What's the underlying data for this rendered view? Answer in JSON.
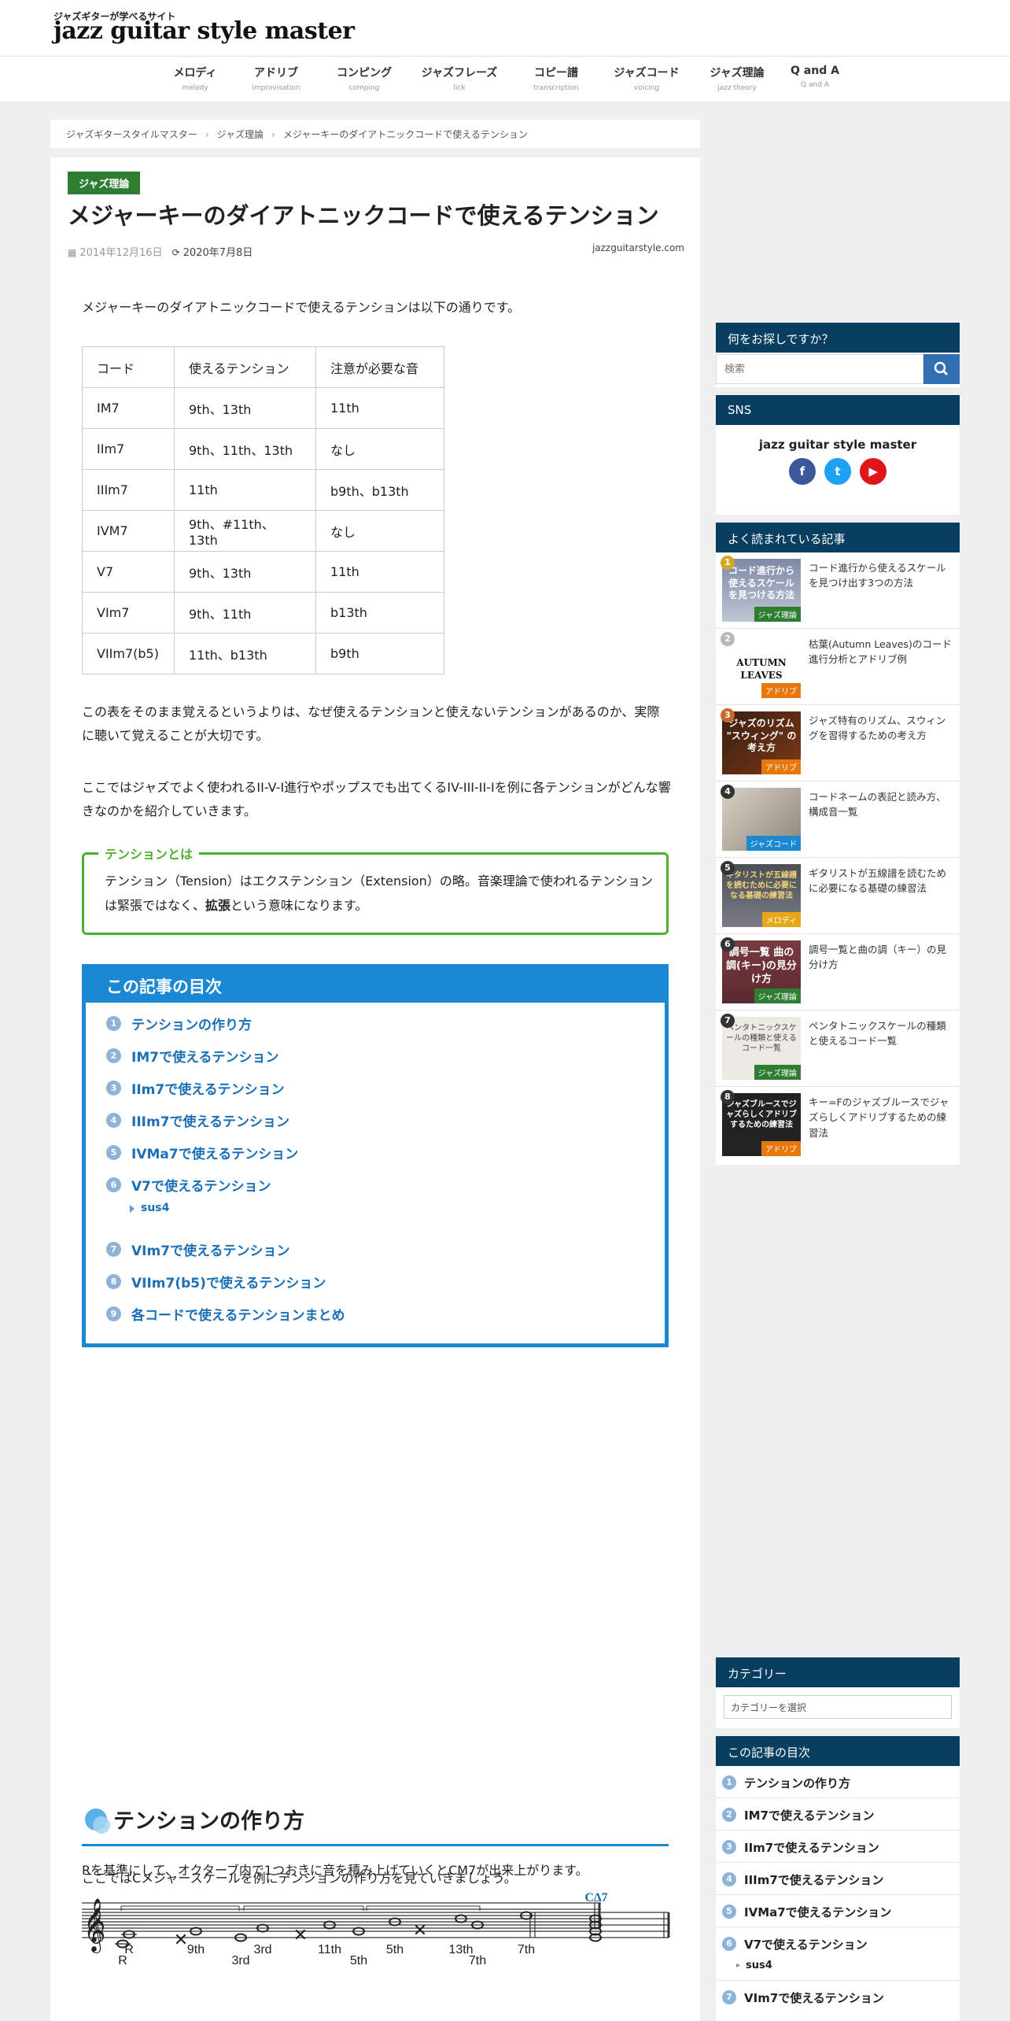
{
  "header": {
    "tagline": "ジャズギターが学べるサイト",
    "logo": "jazz guitar style master"
  },
  "nav": [
    {
      "label": "メロディ",
      "sub": "melody"
    },
    {
      "label": "アドリブ",
      "sub": "improvisation"
    },
    {
      "label": "コンピング",
      "sub": "comping"
    },
    {
      "label": "ジャズフレーズ",
      "sub": "lick"
    },
    {
      "label": "コピー譜",
      "sub": "transcription"
    },
    {
      "label": "ジャズコード",
      "sub": "voicing"
    },
    {
      "label": "ジャズ理論",
      "sub": "jazz theory"
    },
    {
      "label": "Q and A",
      "sub": "Q and A"
    }
  ],
  "breadcrumb": [
    "ジャズギタースタイルマスター",
    "ジャズ理論",
    "メジャーキーのダイアトニックコードで使えるテンション"
  ],
  "article": {
    "category": "ジャズ理論",
    "title": "メジャーキーのダイアトニックコードで使えるテンション",
    "published": "2014年12月16日",
    "modified": "2020年7月8日",
    "domain": "jazzguitarstyle.com",
    "intro": "メジャーキーのダイアトニックコードで使えるテンションは以下の通りです。",
    "table": {
      "headers": [
        "コード",
        "使えるテンション",
        "注意が必要な音"
      ],
      "rows": [
        [
          "IM7",
          "9th、13th",
          "11th"
        ],
        [
          "IIm7",
          "9th、11th、13th",
          "なし"
        ],
        [
          "IIIm7",
          "11th",
          "b9th、b13th"
        ],
        [
          "IVM7",
          "9th、#11th、13th",
          "なし"
        ],
        [
          "V7",
          "9th、13th",
          "11th"
        ],
        [
          "VIm7",
          "9th、11th",
          "b13th"
        ],
        [
          "VIIm7(b5)",
          "11th、b13th",
          "b9th"
        ]
      ]
    },
    "para1": "この表をそのまま覚えるというよりは、なぜ使えるテンションと使えないテンションがあるのか、実際に聴いて覚えることが大切です。",
    "para2": "ここではジャズでよく使われるII-V-I進行やポップスでも出てくるIV-III-II-Iを例に各テンションがどんな響きなのかを紹介していきます。",
    "box": {
      "title": "テンションとは",
      "text_before": "テンション（Tension）はエクステンション（Extension）の略。音楽理論で使われるテンションは緊張ではなく、",
      "text_bold": "拡張",
      "text_after": "という意味になります。"
    },
    "toc": {
      "title": "この記事の目次",
      "items": [
        "テンションの作り方",
        "IM7で使えるテンション",
        "IIm7で使えるテンション",
        "IIIm7で使えるテンション",
        "IVMa7で使えるテンション",
        "V7で使えるテンション",
        "VIm7で使えるテンション",
        "VIIm7(b5)で使えるテンション",
        "各コードで使えるテンションまとめ"
      ],
      "sub_item": "sus4"
    },
    "h2": "テンションの作り方",
    "para3": "ここではCメジャースケールを例にテンションの作り方を見ていきましょう。",
    "score1_labels": [
      "R",
      "9th",
      "3rd",
      "11th",
      "5th",
      "13th",
      "7th"
    ],
    "para4": "Rを基準にして、オクターブ内で1つおきに音を積み上げていくとCM7が出来上がります。",
    "score2_labels": [
      "R",
      "3rd",
      "5th",
      "7th"
    ],
    "score2_chord": "C∆7"
  },
  "sidebar": {
    "search": {
      "title": "何をお探しですか？",
      "placeholder": "検索"
    },
    "sns": {
      "title": "SNS",
      "name": "jazz guitar style master",
      "icons": [
        "facebook-icon",
        "twitter-icon",
        "youtube-icon"
      ]
    },
    "popular": {
      "title": "よく読まれている記事",
      "items": [
        {
          "rank": "1",
          "title": "コード進行から使えるスケールを見つけ出す3つの方法",
          "tag": "ジャズ理論",
          "thumb_text": "コード進行から使えるスケールを見つける方法"
        },
        {
          "rank": "2",
          "title": "枯葉(Autumn Leaves)のコード進行分析とアドリブ例",
          "tag": "アドリブ",
          "thumb_text": "AUTUMN LEAVES"
        },
        {
          "rank": "3",
          "title": "ジャズ特有のリズム、スウィングを習得するための考え方",
          "tag": "アドリブ",
          "thumb_text": "ジャズのリズム \"スウィング\" の考え方"
        },
        {
          "rank": "4",
          "title": "コードネームの表記と読み方、構成音一覧",
          "tag": "ジャズコード",
          "thumb_text": ""
        },
        {
          "rank": "5",
          "title": "ギタリストが五線譜を読むために必要になる基礎の練習法",
          "tag": "メロディ",
          "thumb_text": "ギタリストが五線譜を読むために必要になる基礎の練習法"
        },
        {
          "rank": "6",
          "title": "調号一覧と曲の調（キー）の見分け方",
          "tag": "ジャズ理論",
          "thumb_text": "調号一覧 曲の調(キー)の見分け方"
        },
        {
          "rank": "7",
          "title": "ペンタトニックスケールの種類と使えるコード一覧",
          "tag": "ジャズ理論",
          "thumb_text": "ペンタトニックスケールの種類と使えるコード一覧"
        },
        {
          "rank": "8",
          "title": "キー=Fのジャズブルースでジャズらしくアドリブするための練習法",
          "tag": "アドリブ",
          "thumb_text": "ジャズブルースでジャズらしくアドリブするための練習法"
        }
      ]
    },
    "category": {
      "title": "カテゴリー",
      "placeholder": "カテゴリーを選択"
    },
    "toc": {
      "title": "この記事の目次",
      "items": [
        "テンションの作り方",
        "IM7で使えるテンション",
        "IIm7で使えるテンション",
        "IIIm7で使えるテンション",
        "IVMa7で使えるテンション",
        "V7で使えるテンション",
        "VIm7で使えるテンション"
      ],
      "sub_item": "sus4"
    }
  },
  "colors": {
    "accent": "#1a88d3",
    "widget_head": "#083e60",
    "badge": "#2e7d32",
    "box_border": "#4caf30"
  }
}
